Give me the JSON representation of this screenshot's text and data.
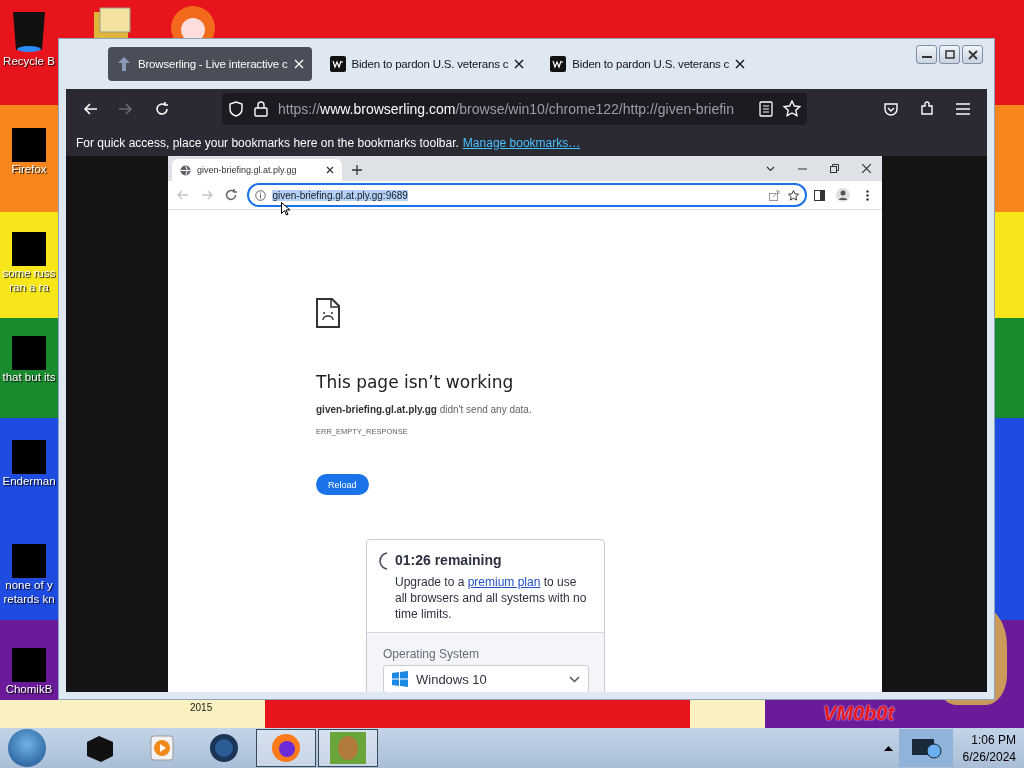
{
  "desktop": {
    "icons": [
      {
        "kind": "bin",
        "label_lines": [
          "Recycle B"
        ]
      },
      {
        "kind": "redacted",
        "label_lines": [
          "Firefox"
        ]
      },
      {
        "kind": "redacted",
        "label_lines": [
          "some russ",
          "ran a ra"
        ]
      },
      {
        "kind": "redacted",
        "label_lines": [
          "that but its"
        ]
      },
      {
        "kind": "redacted",
        "label_lines": [
          "Enderman"
        ]
      },
      {
        "kind": "redacted",
        "label_lines": [
          "none of y",
          "retards kn"
        ]
      },
      {
        "kind": "redacted",
        "label_lines": [
          "ChomikB"
        ]
      }
    ],
    "wallpaper_texts": [
      "2015",
      "VM0b0t"
    ]
  },
  "browser": {
    "tabs": [
      {
        "kind": "browserling",
        "title": "Browserling - Live interactive c",
        "selected": true
      },
      {
        "kind": "wp",
        "title": "Biden to pardon U.S. veterans c",
        "selected": false
      },
      {
        "kind": "wp",
        "title": "Biden to pardon U.S. veterans c",
        "selected": false
      }
    ],
    "nav_buttons": [
      {
        "kind": "back",
        "disabled": false
      },
      {
        "kind": "forward",
        "disabled": true
      },
      {
        "kind": "reload",
        "disabled": false
      }
    ],
    "url": {
      "scheme": "https://",
      "host": "www.browserling.com",
      "path": "/browse/win10/chrome122/http://given-briefin"
    },
    "bookmarks_hint": "For quick access, place your bookmarks here on the bookmarks toolbar.",
    "bookmarks_link": "Manage bookmarks…"
  },
  "page": {
    "tab_title": "given-briefing.gl.at.ply.gg",
    "nav_buttons": [
      {
        "kind": "back",
        "disabled": true
      },
      {
        "kind": "forward",
        "disabled": true
      },
      {
        "kind": "reload",
        "disabled": false
      }
    ],
    "omnibox": {
      "value": "given-briefing.gl.at.ply.gg:9689",
      "selected": true
    },
    "error": {
      "heading": "This page isn’t working",
      "message": "**given-briefing.gl.at.ply.gg** didn't send any data.",
      "code": "ERR_EMPTY_RESPONSE",
      "button": "Reload"
    }
  },
  "timer_card": {
    "title": "01:26 remaining",
    "text_before": "Upgrade to a ",
    "link": "premium plan",
    "text_after": " to use all browsers and all systems with no time limits.",
    "os_label": "Operating System",
    "os_value": "Windows 10"
  },
  "taskbar": {
    "apps": [
      {
        "kind": "black-box",
        "active": false
      },
      {
        "kind": "media",
        "active": false
      },
      {
        "kind": "globe",
        "active": false
      },
      {
        "kind": "firefox",
        "active": true
      },
      {
        "kind": "chomik",
        "active": true
      }
    ],
    "time": "1:06 PM",
    "date": "6/26/2024"
  }
}
